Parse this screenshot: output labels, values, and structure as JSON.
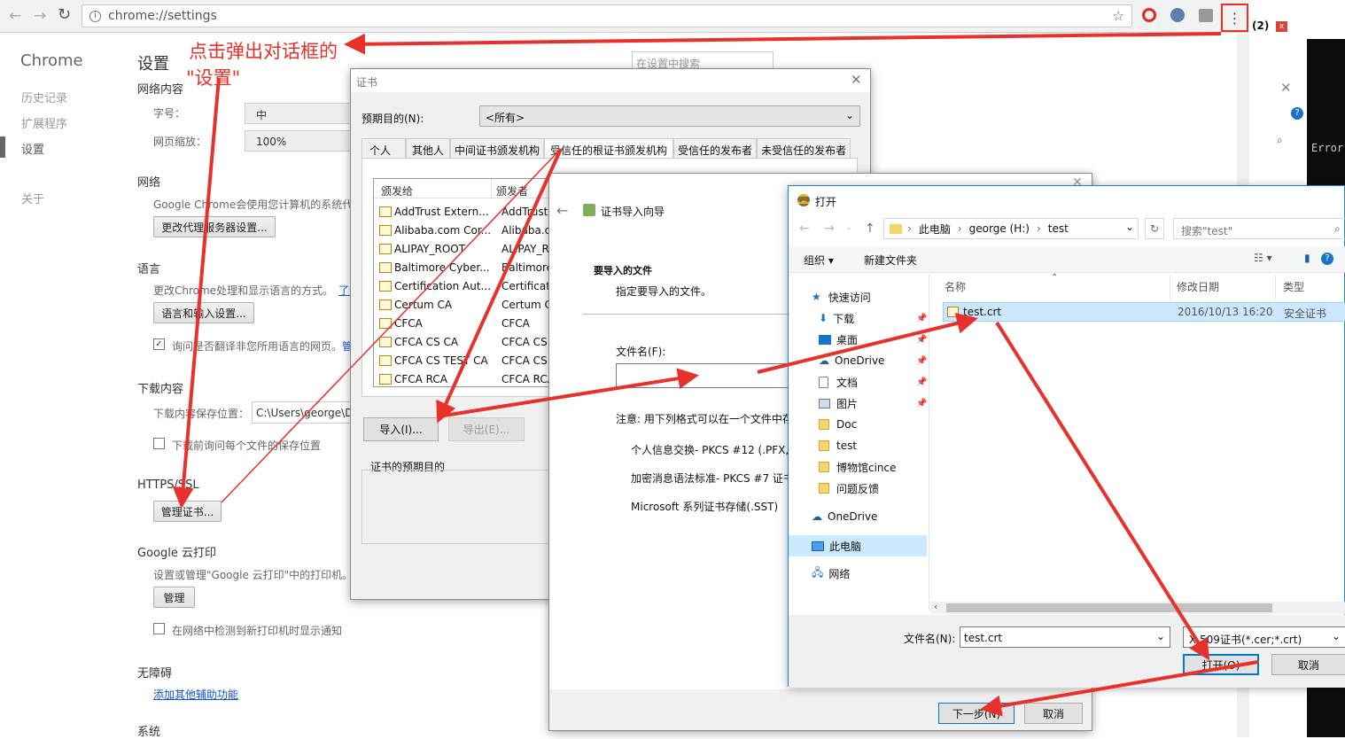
{
  "chrome": {
    "url": "chrome://settings",
    "badge": "(2)"
  },
  "sidebar": {
    "title": "Chrome",
    "items": [
      "历史记录",
      "扩展程序",
      "设置",
      "关于"
    ]
  },
  "settings": {
    "title": "设置",
    "search_placeholder": "在设置中搜索",
    "web_content": {
      "heading": "网络内容",
      "font_label": "字号：",
      "font_value": "中",
      "zoom_label": "网页缩放：",
      "zoom_value": "100%"
    },
    "network": {
      "heading": "网络",
      "desc": "Google Chrome会使用您计算机的系统代理",
      "button": "更改代理服务器设置..."
    },
    "language": {
      "heading": "语言",
      "desc": "更改Chrome处理和显示语言的方式。",
      "link": "了解",
      "button": "语言和输入设置...",
      "check_label": "询问是否翻译非您所用语言的网页。",
      "check_link": "管"
    },
    "downloads": {
      "heading": "下载内容",
      "path_label": "下载内容保存位置：",
      "path_value": "C:\\Users\\george\\Dow",
      "check_label": "下载前询问每个文件的保存位置"
    },
    "https": {
      "heading": "HTTPS/SSL",
      "button": "管理证书..."
    },
    "cloudprint": {
      "heading": "Google 云打印",
      "desc": "设置或管理\"Google 云打印\"中的打印机。",
      "button": "管理",
      "check_label": "在网络中检测到新打印机时显示通知"
    },
    "a11y": {
      "heading": "无障碍",
      "link": "添加其他辅助功能"
    },
    "system": {
      "heading": "系统"
    }
  },
  "annotation": {
    "line1": "点击弹出对话框的",
    "line2": "\"设置\""
  },
  "cert": {
    "title": "证书",
    "purpose_label": "预期目的(N):",
    "purpose_value": "<所有>",
    "tabs": [
      "个人",
      "其他人",
      "中间证书颁发机构",
      "受信任的根证书颁发机构",
      "受信任的发布者",
      "未受信任的发布者"
    ],
    "columns": [
      "颁发给",
      "颁发者"
    ],
    "rows": [
      [
        "AddTrust Extern...",
        "AddTrust E"
      ],
      [
        "Alibaba.com Cor...",
        "Alibaba.co"
      ],
      [
        "ALIPAY_ROOT",
        "ALIPAY_RC"
      ],
      [
        "Baltimore Cyber...",
        "Baltimore"
      ],
      [
        "Certification Aut...",
        "Certificatic"
      ],
      [
        "Certum CA",
        "Certum CA"
      ],
      [
        "CFCA",
        "CFCA"
      ],
      [
        "CFCA CS CA",
        "CFCA CS C"
      ],
      [
        "CFCA CS TEST CA",
        "CFCA CS T"
      ],
      [
        "CFCA RCA",
        "CFCA RCA"
      ]
    ],
    "import_btn": "导入(I)...",
    "export_btn": "导出(E)...",
    "purpose_group": "证书的预期目的"
  },
  "wizard": {
    "title": "证书导入向导",
    "section_title": "要导入的文件",
    "section_desc": "指定要导入的文件。",
    "file_label": "文件名(F):",
    "note": "注意: 用下列格式可以在一个文件中存",
    "formats": [
      "个人信息交换- PKCS #12 (.PFX,.P",
      "加密消息语法标准- PKCS #7 证书",
      "Microsoft 系列证书存储(.SST)"
    ],
    "next_btn": "下一步(N)",
    "cancel_btn": "取消"
  },
  "opendlg": {
    "title": "打开",
    "breadcrumb": [
      "此电脑",
      "george (H:)",
      "test"
    ],
    "search_placeholder": "搜索\"test\"",
    "organize": "组织 ▾",
    "new_folder": "新建文件夹",
    "nav": [
      {
        "label": "快速访问",
        "icon": "star-icon"
      },
      {
        "label": "下载",
        "icon": "download-icon"
      },
      {
        "label": "桌面",
        "icon": "desktop-icon"
      },
      {
        "label": "OneDrive",
        "icon": "cloud-icon"
      },
      {
        "label": "文档",
        "icon": "document-icon"
      },
      {
        "label": "图片",
        "icon": "picture-icon"
      },
      {
        "label": "Doc",
        "icon": "folder-icon"
      },
      {
        "label": "test",
        "icon": "folder-icon"
      },
      {
        "label": "博物馆cince",
        "icon": "folder-icon"
      },
      {
        "label": "问题反馈",
        "icon": "folder-icon"
      },
      {
        "label": "OneDrive",
        "icon": "cloud-icon"
      },
      {
        "label": "此电脑",
        "icon": "pc-icon"
      },
      {
        "label": "网络",
        "icon": "network-icon"
      }
    ],
    "columns": [
      "名称",
      "修改日期",
      "类型"
    ],
    "file": {
      "name": "test.crt",
      "date": "2016/10/13 16:20",
      "type": "安全证书"
    },
    "filename_label": "文件名(N):",
    "filename_value": "test.crt",
    "filter": "X.509证书(*.cer;*.crt)",
    "open_btn": "打开(O)",
    "cancel_btn": "取消"
  },
  "console": {
    "text": "Error"
  },
  "colors": {
    "arrow": "#e8312a",
    "accent": "#0078d7"
  }
}
